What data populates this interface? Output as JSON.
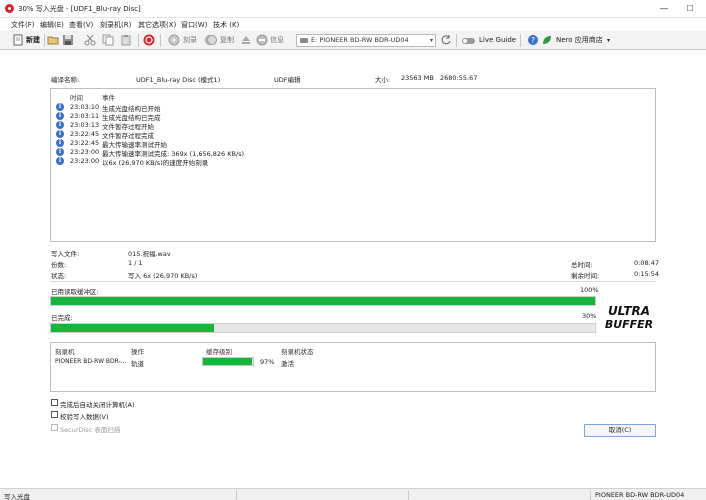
{
  "window": {
    "title": "30% 写入光盘 - [UDF1_Blu-ray Disc]",
    "minimize_glyph": "—",
    "maximize_glyph": "☐",
    "close_glyph": "✕"
  },
  "menu": [
    "文件(F)",
    "编辑(E)",
    "查看(V)",
    "刻录机(R)",
    "其它选项(X)",
    "窗口(W)",
    "技术 (K)"
  ],
  "toolbar": {
    "new_label": "新建",
    "burn_label": "刻录",
    "copy_label": "复制",
    "erase_label": "信息",
    "drive_label": "E: PIONEER BD-RW   BDR-UD04",
    "drive_dropdown": "▾",
    "live_guide_label": "Live Guide",
    "nero_store_label": "Nero 应用商店"
  },
  "compilation": {
    "name_label": "编译名称:",
    "name_value": "UDF1_Blu-ray Disc (模式1)",
    "type_value": "UDF编辑",
    "size_label": "大小:",
    "size_value": "23563 MB",
    "time_value": "2680:55.67"
  },
  "log": {
    "col_time": "时间",
    "col_event": "事件",
    "rows": [
      {
        "time": "23:03:10",
        "event": "生成光盘结构已开始"
      },
      {
        "time": "23:03:11",
        "event": "生成光盘结构已完成"
      },
      {
        "time": "23:03:13",
        "event": "文件暂存过程开始"
      },
      {
        "time": "23:22:45",
        "event": "文件暂存过程完成"
      },
      {
        "time": "23:22:45",
        "event": "最大传输速率测试开始"
      },
      {
        "time": "23:23:00",
        "event": "最大传输速率测试完成: 369x (1,656,826 KB/s)"
      },
      {
        "time": "23:23:00",
        "event": "以6x (26,970 KB/s)的速度开始刻录"
      }
    ]
  },
  "progress": {
    "writing_file_label": "写入文件:",
    "writing_file_value": "015.祝福.wav",
    "copies_label": "份数:",
    "copies_value": "1 / 1",
    "status_label": "状态:",
    "status_value": "写入 6x (26,970 KB/s)",
    "total_time_label": "总时间:",
    "total_time_value": "0:08:47",
    "remaining_time_label": "剩余时间:",
    "remaining_time_value": "0:15:54",
    "buffer_label": "已用读取缓冲区:",
    "buffer_percent_text": "100%",
    "buffer_fraction": 1.0,
    "done_label": "已完成:",
    "done_percent_text": "30%",
    "done_fraction": 0.3
  },
  "ultra_buffer": {
    "line1": "ULTRA",
    "line2": "BUFFER"
  },
  "recorder": {
    "headers": [
      "刻录机",
      "操作",
      "缓存级别",
      "刻录机状态"
    ],
    "row": {
      "name": "PIONEER BD-RW   BDR-...",
      "operation": "轨道",
      "buffer_percent_text": "97%",
      "buffer_fraction": 0.97,
      "status": "激活"
    }
  },
  "options": {
    "shutdown_label": "完成后自动关闭计算机(A)",
    "verify_label": "校验写入数据(V)",
    "securdisc_label": "SecurDisc 表面扫描"
  },
  "cancel_label": "取消(C)",
  "statusbar": {
    "left": "写入光盘",
    "right": "PIONEER  BD-RW   BDR-UD04"
  },
  "colors": {
    "progress_green": "#19b53a",
    "info_blue": "#3b6fc9",
    "nero_red": "#d6232a"
  }
}
